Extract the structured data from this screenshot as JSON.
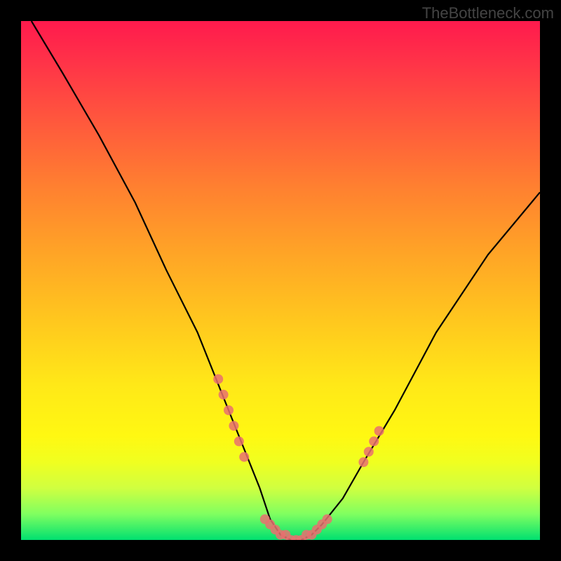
{
  "watermark": "TheBottleneck.com",
  "chart_data": {
    "type": "line",
    "title": "",
    "xlabel": "",
    "ylabel": "",
    "xlim": [
      0,
      100
    ],
    "ylim": [
      0,
      100
    ],
    "series": [
      {
        "name": "bottleneck-curve",
        "x": [
          2,
          8,
          15,
          22,
          28,
          34,
          38,
          42,
          46,
          48,
          50,
          52,
          54,
          56,
          58,
          62,
          66,
          72,
          80,
          90,
          100
        ],
        "y": [
          100,
          90,
          78,
          65,
          52,
          40,
          30,
          20,
          10,
          4,
          1,
          0,
          0,
          1,
          3,
          8,
          15,
          25,
          40,
          55,
          67
        ]
      }
    ],
    "markers": [
      {
        "name": "left-cluster",
        "style": "salmon-dot",
        "points": [
          {
            "x": 38,
            "y": 31
          },
          {
            "x": 39,
            "y": 28
          },
          {
            "x": 40,
            "y": 25
          },
          {
            "x": 41,
            "y": 22
          },
          {
            "x": 42,
            "y": 19
          },
          {
            "x": 43,
            "y": 16
          }
        ]
      },
      {
        "name": "bottom-cluster",
        "style": "salmon-dot",
        "points": [
          {
            "x": 47,
            "y": 4
          },
          {
            "x": 48,
            "y": 3
          },
          {
            "x": 49,
            "y": 2
          },
          {
            "x": 50,
            "y": 1
          },
          {
            "x": 51,
            "y": 1
          },
          {
            "x": 52,
            "y": 0
          },
          {
            "x": 53,
            "y": 0
          },
          {
            "x": 54,
            "y": 0
          },
          {
            "x": 55,
            "y": 1
          },
          {
            "x": 56,
            "y": 1
          },
          {
            "x": 57,
            "y": 2
          },
          {
            "x": 58,
            "y": 3
          },
          {
            "x": 59,
            "y": 4
          }
        ]
      },
      {
        "name": "right-cluster",
        "style": "salmon-dot",
        "points": [
          {
            "x": 66,
            "y": 15
          },
          {
            "x": 67,
            "y": 17
          },
          {
            "x": 68,
            "y": 19
          },
          {
            "x": 69,
            "y": 21
          }
        ]
      }
    ],
    "gradient_background": {
      "direction": "vertical",
      "stops": [
        {
          "pos": 0,
          "color": "#ff1a4d"
        },
        {
          "pos": 50,
          "color": "#ffc81e"
        },
        {
          "pos": 100,
          "color": "#00e070"
        }
      ]
    }
  }
}
